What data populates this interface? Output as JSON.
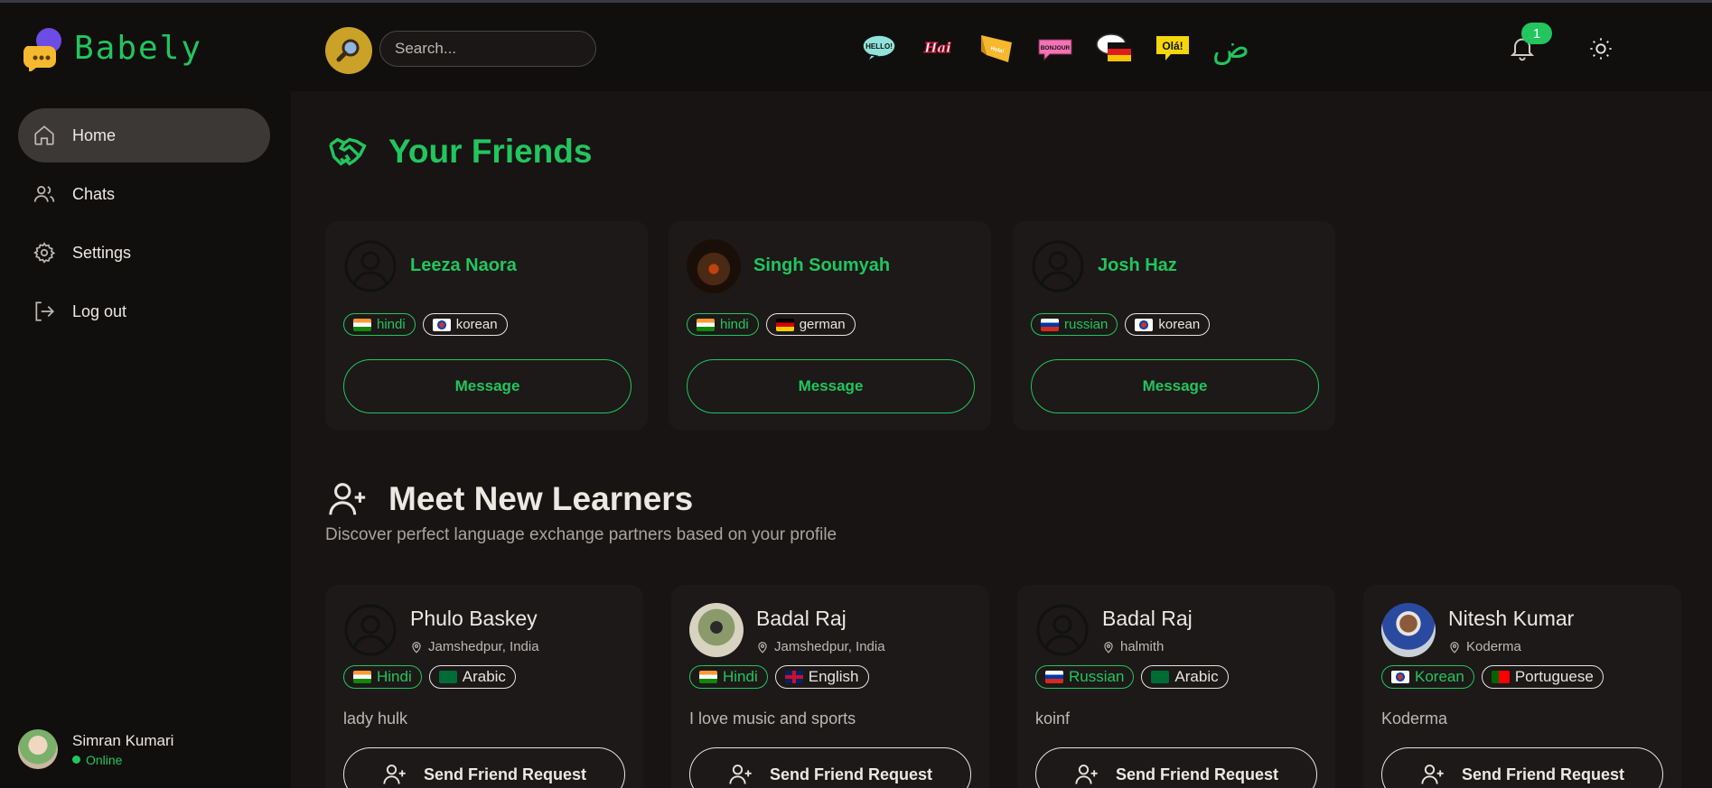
{
  "app": {
    "name": "Babely"
  },
  "search": {
    "placeholder": "Search..."
  },
  "header": {
    "notification_count": "1",
    "hello_labels": [
      "HELLO!",
      "Hai",
      "Hola!",
      "BONJOUR",
      "Olá!",
      "ض"
    ]
  },
  "nav": {
    "items": [
      {
        "label": "Home"
      },
      {
        "label": "Chats"
      },
      {
        "label": "Settings"
      },
      {
        "label": "Log out"
      }
    ]
  },
  "user": {
    "name": "Simran Kumari",
    "status": "Online"
  },
  "friends": {
    "title": "Your Friends",
    "button_label": "Message",
    "cards": [
      {
        "name": "Leeza Naora",
        "native": "hindi",
        "learning": "korean"
      },
      {
        "name": "Singh Soumyah",
        "native": "hindi",
        "learning": "german"
      },
      {
        "name": "Josh Haz",
        "native": "russian",
        "learning": "korean"
      }
    ]
  },
  "learners": {
    "title": "Meet New Learners",
    "subtitle": "Discover perfect language exchange partners based on your profile",
    "button_label": "Send Friend Request",
    "cards": [
      {
        "name": "Phulo Baskey",
        "location": "Jamshedpur, India",
        "native": "Hindi",
        "learning": "Arabic",
        "bio": "lady hulk"
      },
      {
        "name": "Badal Raj",
        "location": "Jamshedpur, India",
        "native": "Hindi",
        "learning": "English",
        "bio": "I love music and sports"
      },
      {
        "name": "Badal Raj",
        "location": "halmith",
        "native": "Russian",
        "learning": "Arabic",
        "bio": "koinf"
      },
      {
        "name": "Nitesh Kumar",
        "location": "Koderma",
        "native": "Korean",
        "learning": "Portuguese",
        "bio": "Koderma"
      }
    ]
  },
  "colors": {
    "accent": "#22c55e",
    "background": "#171413",
    "sidebar": "#110f0e",
    "card": "#1c1918"
  }
}
